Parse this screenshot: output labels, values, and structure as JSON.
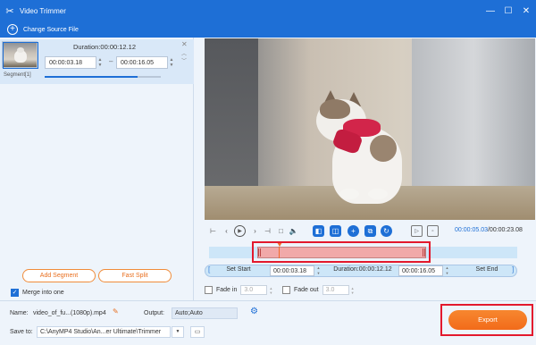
{
  "window": {
    "title": "Video Trimmer"
  },
  "toolbar": {
    "change_source_label": "Change Source File"
  },
  "segment": {
    "label": "Segment[1]",
    "duration": "Duration:00:00:12.12",
    "start": "00:00:03.18",
    "end": "00:00:16.05",
    "progress": 0.8
  },
  "left_actions": {
    "add_segment": "Add Segment",
    "fast_split": "Fast Split",
    "merge_label": "Merge into one",
    "merge_checked": true
  },
  "player": {
    "current_time": "00:00:05.03",
    "total_time": "/00:00:23.08"
  },
  "trim": {
    "set_start": "Set Start",
    "start_value": "00:00:03.18",
    "duration": "Duration:00:00:12.12",
    "end_value": "00:00:16.05",
    "set_end": "Set End"
  },
  "fade": {
    "in_label": "Fade in",
    "in_value": "3.0",
    "out_label": "Fade out",
    "out_value": "3.0"
  },
  "bottom": {
    "name_label": "Name:",
    "name_value": "video_of_fu...(1080p).mp4",
    "output_label": "Output:",
    "output_value": "Auto;Auto",
    "save_label": "Save to:",
    "save_value": "C:\\AnyMP4 Studio\\An...er Ultimate\\Trimmer",
    "export_label": "Export"
  },
  "colors": {
    "accent": "#1e6fd6",
    "export": "#f26b1a",
    "highlight": "#e3192d"
  }
}
